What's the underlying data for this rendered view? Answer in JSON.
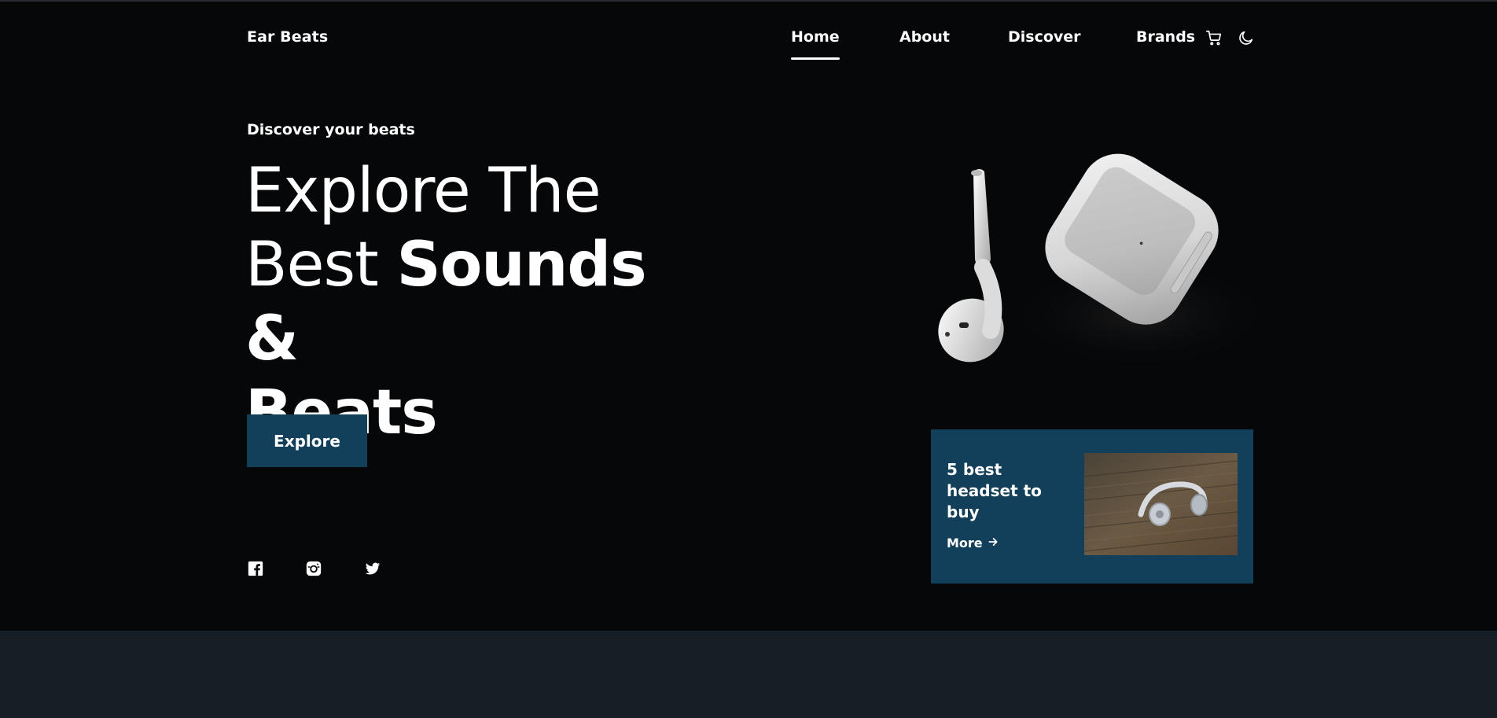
{
  "header": {
    "brand": "Ear Beats",
    "nav": [
      {
        "label": "Home",
        "active": true
      },
      {
        "label": "About",
        "active": false
      },
      {
        "label": "Discover",
        "active": false
      },
      {
        "label": "Brands",
        "active": false
      }
    ],
    "icons": [
      "cart-icon",
      "moon-icon"
    ]
  },
  "hero": {
    "subtitle": "Discover your beats",
    "headline_line1": "Explore The",
    "headline_line2_light": "Best",
    "headline_line2_bold": "Sounds &",
    "headline_line3_bold": "Beats",
    "cta_label": "Explore",
    "social_icons": [
      "facebook-icon",
      "instagram-icon",
      "twitter-icon"
    ]
  },
  "card": {
    "title": "5 best headset to buy",
    "more_label": "More",
    "more_icon": "arrow-right-icon"
  },
  "colors": {
    "background": "#060709",
    "accent": "#12405a",
    "bottom_section": "#161f25",
    "text": "#ffffff"
  }
}
